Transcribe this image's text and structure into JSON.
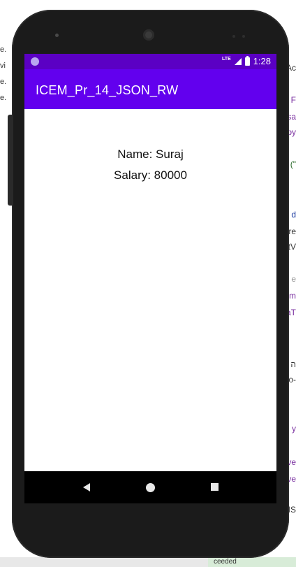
{
  "background": {
    "left_fragments": [
      "e.",
      "vi",
      "e.",
      "e."
    ],
    "right_fragments": [
      "Ac",
      "F",
      "sa",
      "py",
      "(\"",
      "d",
      "re",
      "tV",
      "e",
      "am",
      "aT",
      "ה",
      "o-",
      "y",
      "ve",
      "ve",
      "IS"
    ],
    "bottom_status": "ceeded"
  },
  "status_bar": {
    "network": "LTE",
    "time": "1:28"
  },
  "app_bar": {
    "title": "ICEM_Pr_14_JSON_RW"
  },
  "content": {
    "name_line": "Name: Suraj",
    "salary_line": "Salary: 80000"
  },
  "colors": {
    "status_bar": "#5b00c4",
    "app_bar": "#6200ee",
    "nav_bar": "#000000",
    "phone_frame": "#1b1b1b"
  },
  "icons": {
    "status": [
      "status-dot-icon",
      "signal-icon",
      "battery-icon"
    ],
    "nav": [
      "back-icon",
      "home-icon",
      "recents-icon"
    ]
  }
}
